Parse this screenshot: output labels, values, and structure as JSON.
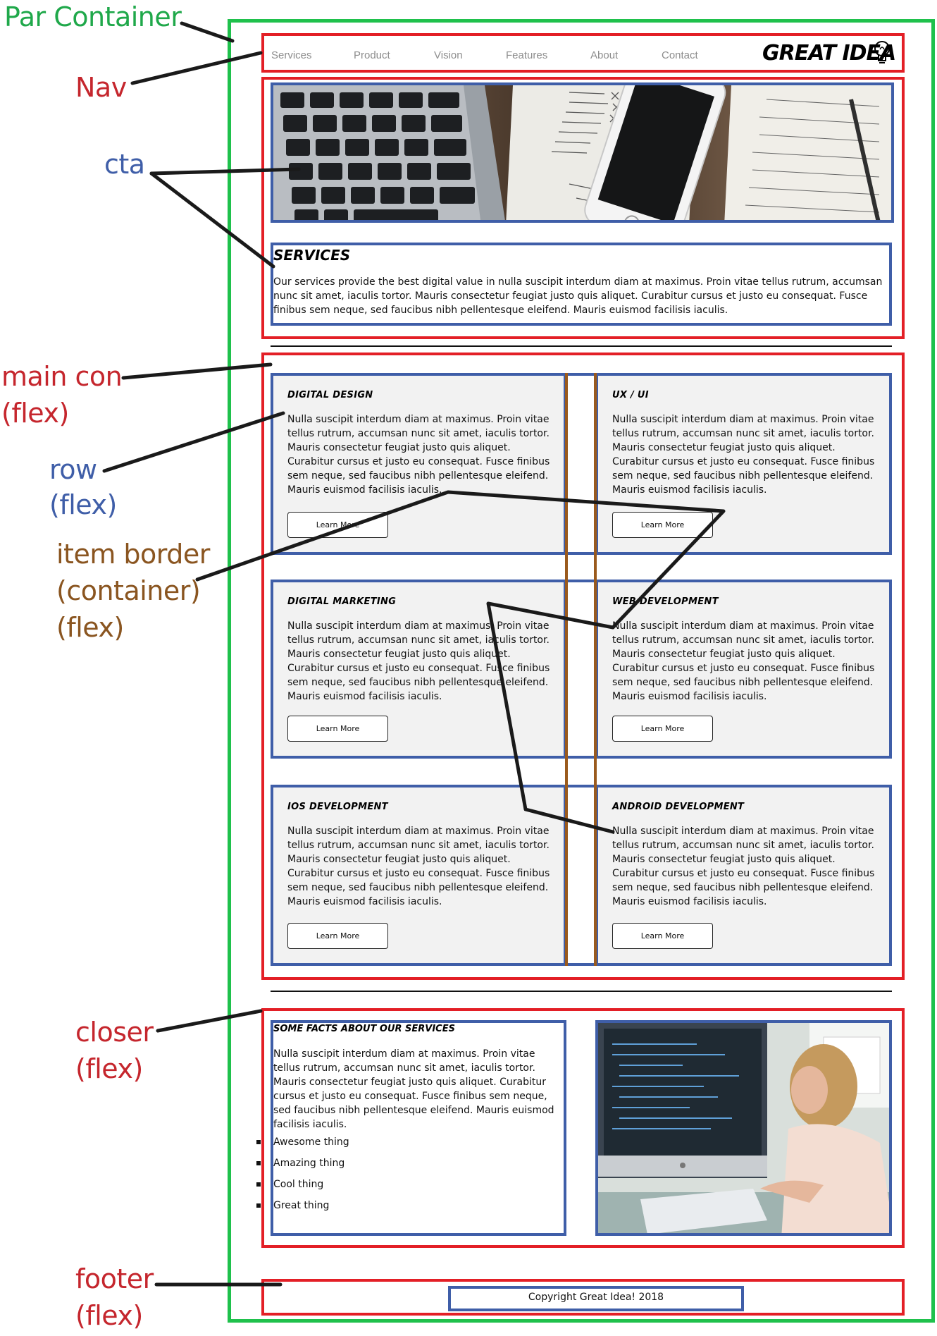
{
  "labels": {
    "par_container": "Par Container",
    "nav": "Nav",
    "cta": "cta",
    "main_con": "main con",
    "main_con_sub": "(flex)",
    "row": "row",
    "row_sub": "(flex)",
    "item_border": "item border",
    "item_border_sub1": "(container)",
    "item_border_sub2": "(flex)",
    "closer": "closer",
    "closer_sub": "(flex)",
    "footer": "footer",
    "footer_sub": "(flex)"
  },
  "colors": {
    "par_container": "#1fc14c",
    "red_boxes": "#e31f26",
    "blue_boxes": "#3f5ea8",
    "item_border": "#9a5a1d"
  },
  "nav": {
    "links": [
      "Services",
      "Product",
      "Vision",
      "Features",
      "About",
      "Contact"
    ],
    "logo": "GREAT IDEA",
    "logo_icon": "lightbulb-icon"
  },
  "services": {
    "title": "SERVICES",
    "text": "Our services provide the best digital value in nulla suscipit interdum diam at maximus. Proin vitae tellus rutrum, accumsan nunc sit amet, iaculis tortor. Mauris consectetur feugiat justo quis aliquet. Curabitur cursus et justo eu consequat. Fusce finibus sem neque, sed faucibus nibh pellentesque eleifend. Mauris euismod facilisis iaculis."
  },
  "cards": [
    {
      "title": "DIGITAL DESIGN",
      "text": "Nulla suscipit interdum diam at maximus. Proin vitae tellus rutrum, accumsan nunc sit amet, iaculis tortor. Mauris consectetur feugiat justo quis aliquet. Curabitur cursus et justo eu consequat. Fusce finibus sem neque, sed faucibus nibh pellentesque eleifend. Mauris euismod facilisis iaculis.",
      "button": "Learn More"
    },
    {
      "title": "UX / UI",
      "text": "Nulla suscipit interdum diam at maximus. Proin vitae tellus rutrum, accumsan nunc sit amet, iaculis tortor. Mauris consectetur feugiat justo quis aliquet. Curabitur cursus et justo eu consequat. Fusce finibus sem neque, sed faucibus nibh pellentesque eleifend. Mauris euismod facilisis iaculis.",
      "button": "Learn More"
    },
    {
      "title": "DIGITAL MARKETING",
      "text": "Nulla suscipit interdum diam at maximus. Proin vitae tellus rutrum, accumsan nunc sit amet, iaculis tortor. Mauris consectetur feugiat justo quis aliquet. Curabitur cursus et justo eu consequat. Fusce finibus sem neque, sed faucibus nibh pellentesque eleifend. Mauris euismod facilisis iaculis.",
      "button": "Learn More"
    },
    {
      "title": "WEB DEVELOPMENT",
      "text": "Nulla suscipit interdum diam at maximus. Proin vitae tellus rutrum, accumsan nunc sit amet, iaculis tortor. Mauris consectetur feugiat justo quis aliquet. Curabitur cursus et justo eu consequat. Fusce finibus sem neque, sed faucibus nibh pellentesque eleifend. Mauris euismod facilisis iaculis.",
      "button": "Learn More"
    },
    {
      "title": "IOS DEVELOPMENT",
      "text": "Nulla suscipit interdum diam at maximus. Proin vitae tellus rutrum, accumsan nunc sit amet, iaculis tortor. Mauris consectetur feugiat justo quis aliquet. Curabitur cursus et justo eu consequat. Fusce finibus sem neque, sed faucibus nibh pellentesque eleifend. Mauris euismod facilisis iaculis.",
      "button": "Learn More"
    },
    {
      "title": "ANDROID DEVELOPMENT",
      "text": "Nulla suscipit interdum diam at maximus. Proin vitae tellus rutrum, accumsan nunc sit amet, iaculis tortor. Mauris consectetur feugiat justo quis aliquet. Curabitur cursus et justo eu consequat. Fusce finibus sem neque, sed faucibus nibh pellentesque eleifend. Mauris euismod facilisis iaculis.",
      "button": "Learn More"
    }
  ],
  "facts": {
    "title": "SOME FACTS ABOUT OUR SERVICES",
    "text": "Nulla suscipit interdum diam at maximus. Proin vitae tellus rutrum, accumsan nunc sit amet, iaculis tortor. Mauris consectetur feugiat justo quis aliquet. Curabitur cursus et justo eu consequat. Fusce finibus sem neque, sed faucibus nibh pellentesque eleifend. Mauris euismod facilisis iaculis.",
    "list": [
      "Awesome thing",
      "Amazing thing",
      "Cool thing",
      "Great thing"
    ]
  },
  "footer": {
    "copyright": "Copyright Great Idea! 2018"
  }
}
